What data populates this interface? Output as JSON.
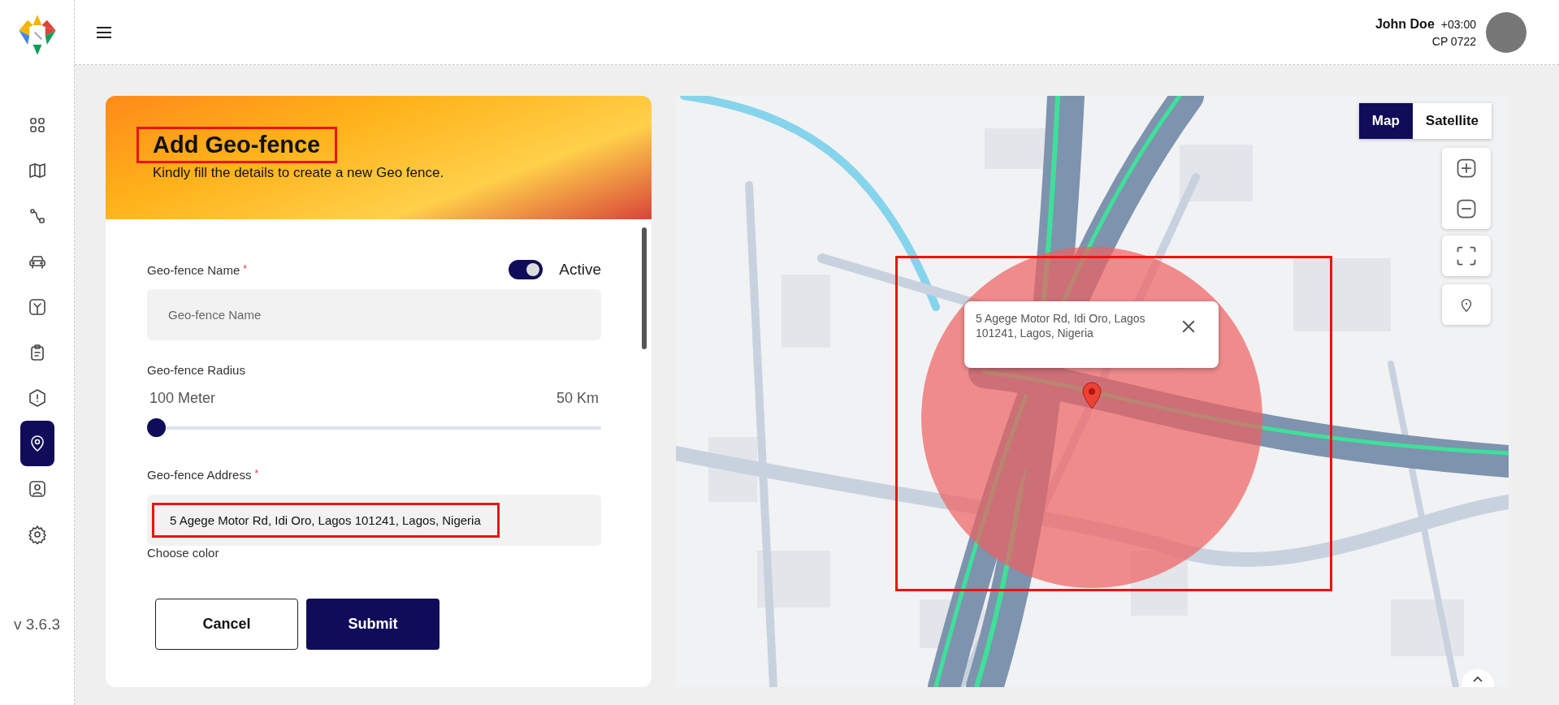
{
  "sidebar": {
    "items": [
      {
        "selected": false
      },
      {
        "selected": false
      },
      {
        "selected": false
      },
      {
        "selected": false
      },
      {
        "selected": false
      },
      {
        "selected": false
      },
      {
        "selected": false
      },
      {
        "selected": true
      },
      {
        "selected": false
      },
      {
        "selected": false
      }
    ],
    "version": "v 3.6.3"
  },
  "header": {
    "user_name": "John Doe",
    "timezone": "+03:00",
    "user_code": "CP 0722"
  },
  "form": {
    "title": "Add Geo-fence",
    "title_highlighted": true,
    "subtitle": "Kindly fill the details to create a new Geo fence.",
    "name_field": {
      "label": "Geo-fence Name",
      "required_mark": "*",
      "placeholder": "Geo-fence Name"
    },
    "active_toggle": {
      "label": "Active",
      "on": true
    },
    "radius": {
      "label": "Geo-fence Radius",
      "min_label": "100 Meter",
      "max_label": "50 Km",
      "level": 0
    },
    "address_field": {
      "label": "Geo-fence Address",
      "required_mark": "*",
      "value": "5 Agege Motor Rd, Idi Oro, Lagos 101241, Lagos, Nigeria",
      "highlighted": true
    },
    "color_label": "Choose color",
    "buttons": [
      {
        "label": "Cancel",
        "kind": "secondary"
      },
      {
        "label": "Submit",
        "kind": "primary"
      }
    ]
  },
  "map": {
    "type_buttons": [
      {
        "label": "Map",
        "selected": true
      },
      {
        "label": "Satellite",
        "selected": false
      }
    ],
    "fence_highlighted": true,
    "popup": {
      "text": "5 Agege Motor Rd, Idi Oro, Lagos 101241, Lagos, Nigeria"
    }
  }
}
